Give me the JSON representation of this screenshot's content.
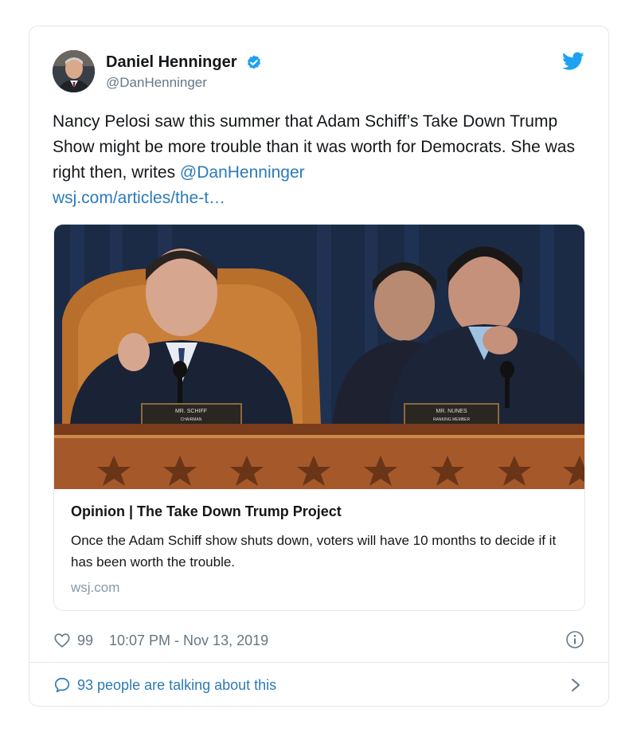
{
  "author": {
    "display_name": "Daniel Henninger",
    "handle": "@DanHenninger",
    "verified": true
  },
  "tweet": {
    "text_before": "Nancy Pelosi saw this summer that Adam Schiff’s Take Down Trump Show might be more trouble than it was worth for Democrats. She was right then, writes ",
    "mention": "@DanHenninger",
    "link": "wsj.com/articles/the-t…"
  },
  "card": {
    "image_alt": "Photo of House Intelligence Committee hearing",
    "nameplate_left": "MR. SCHIFF",
    "nameplate_left_sub": "CHAIRMAN",
    "nameplate_right": "MR. NUNES",
    "nameplate_right_sub": "RANKING MEMBER",
    "title": "Opinion | The Take Down Trump Project",
    "description": "Once the Adam Schiff show shuts down, voters will have 10 months to decide if it has been worth the trouble.",
    "domain": "wsj.com"
  },
  "footer": {
    "likes": "99",
    "timestamp": "10:07 PM - Nov 13, 2019"
  },
  "conversation": {
    "label": "93 people are talking about this"
  },
  "colors": {
    "link": "#2b7bb9",
    "muted": "#657786",
    "border": "#e1e8ed",
    "twitter_blue": "#1da1f2"
  },
  "icons": [
    "twitter-bird-icon",
    "verified-badge-icon",
    "heart-icon",
    "info-icon",
    "speech-bubble-icon",
    "chevron-right-icon"
  ]
}
